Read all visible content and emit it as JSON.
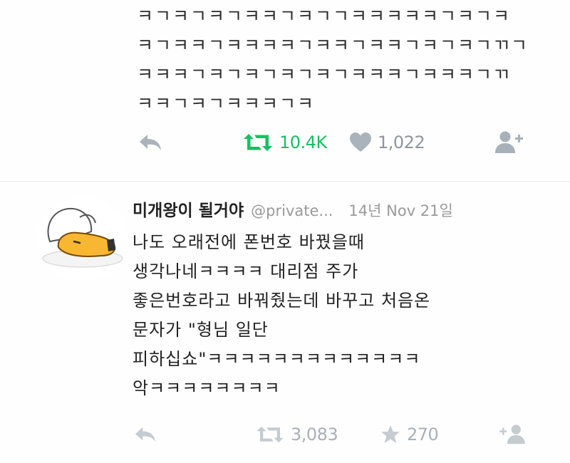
{
  "tweet1": {
    "lines": [
      "ㅋㄱㅋㄱㅋㄱㅋㅋㄱㅋㄱㄱㅋㅋㅋㅋㅋㄱㅋㄱㅋ",
      "ㅋㄱㅋㅋㄱㅋㅋㅋㅋㄱㅋㅋㄱㅋㅋㄱㅋㄱㅋㄱㄲㄱ",
      "ㅋㅋㅋㄱㅋㄱㅋㄱㅋㄱㅋㄱㅋㅋㅋㄱㅋㅋㅋㄱㄲ",
      "ㅋㅋㄱㅋㄱㅋㅋㅋㄱㅋ"
    ],
    "actions": {
      "reply_icon": "reply-arrow-icon",
      "retweet_icon": "retweet-icon",
      "retweet_count": "10.4K",
      "like_icon": "heart-icon",
      "like_count": "1,022",
      "follow_icon": "follow-user-icon"
    },
    "colors": {
      "retweet_active": "#17bf63",
      "icon_gray": "#a8b1b9"
    }
  },
  "tweet2": {
    "avatar": "gudetama-egg-avatar",
    "name": "미개왕이 될거야",
    "handle": "@private...",
    "date": "14년 Nov 21일",
    "lines": [
      "나도 오래전에 폰번호 바꿨을때",
      "생각나네ㅋㅋㅋㅋ  대리점 주가",
      "좋은번호라고 바꿔줬는데 바꾸고 처음온",
      "문자가 \"형님 일단",
      "피하십쇼\"ㅋㅋㅋㅋㅋㅋㅋㅋㅋㅋㅋㅋㅋ",
      "악ㅋㅋㅋㅋㅋㅋㅋㅋ"
    ],
    "actions": {
      "reply_icon": "reply-arrow-icon",
      "retweet_icon": "retweet-icon",
      "retweet_count": "3,083",
      "favorite_icon": "star-icon",
      "favorite_count": "270",
      "follow_icon": "follow-user-icon"
    }
  }
}
